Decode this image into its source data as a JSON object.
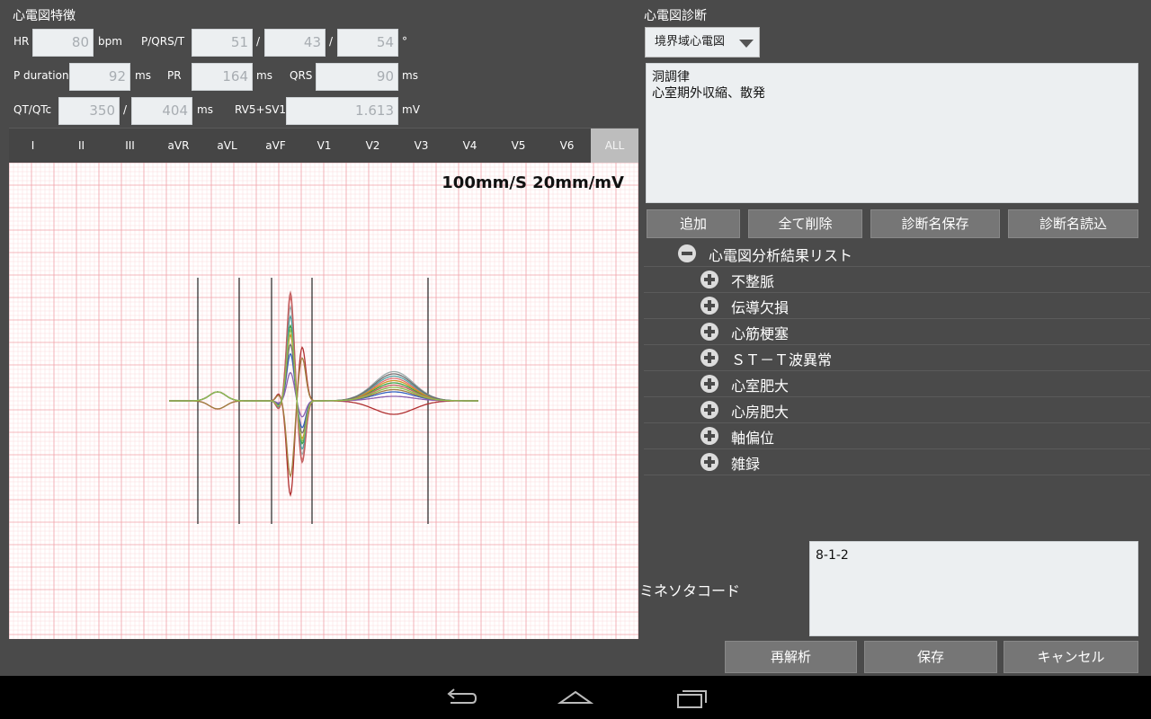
{
  "features": {
    "title": "心電図特徴",
    "hr": {
      "label": "HR",
      "value": "80",
      "unit": "bpm"
    },
    "pqrst": {
      "label": "P/QRS/T",
      "p": "51",
      "qrs": "43",
      "t": "54",
      "sep": "/",
      "unit": "°"
    },
    "pduration": {
      "label": "P duration",
      "value": "92",
      "unit": "ms"
    },
    "pr": {
      "label": "PR",
      "value": "164",
      "unit": "ms"
    },
    "qrs": {
      "label": "QRS",
      "value": "90",
      "unit": "ms"
    },
    "qtqtc": {
      "label": "QT/QTc",
      "qt": "350",
      "qtc": "404",
      "sep": "/",
      "unit": "ms"
    },
    "rv5sv1": {
      "label": "RV5+SV1",
      "value": "1.613",
      "unit": "mV"
    }
  },
  "leads": [
    "I",
    "II",
    "III",
    "aVR",
    "aVL",
    "aVF",
    "V1",
    "V2",
    "V3",
    "V4",
    "V5",
    "V6",
    "ALL"
  ],
  "active_lead": "ALL",
  "ecg": {
    "speed_label": "100mm/S 20mm/mV"
  },
  "diagnosis": {
    "title": "心電図診断",
    "category": "境界域心電図",
    "text_lines": [
      "洞調律",
      "心室期外収縮、散発"
    ],
    "buttons": {
      "add": "追加",
      "clear_all": "全て削除",
      "save_name": "診断名保存",
      "load_name": "診断名読込"
    }
  },
  "analysis_list": {
    "root": "心電図分析結果リスト",
    "items": [
      "不整脈",
      "伝導欠損",
      "心筋梗塞",
      "ＳＴ－Ｔ波異常",
      "心室肥大",
      "心房肥大",
      "軸偏位",
      "雑録"
    ]
  },
  "minnesota": {
    "label": "ミネソタコード",
    "value": "8-1-2"
  },
  "actions": {
    "reanalyze": "再解析",
    "save": "保存",
    "cancel": "キャンセル"
  },
  "colors": {
    "grid_major": "#f0a0a8",
    "grid_minor": "#fbdadd",
    "active_tab": "#bdbdbd"
  }
}
